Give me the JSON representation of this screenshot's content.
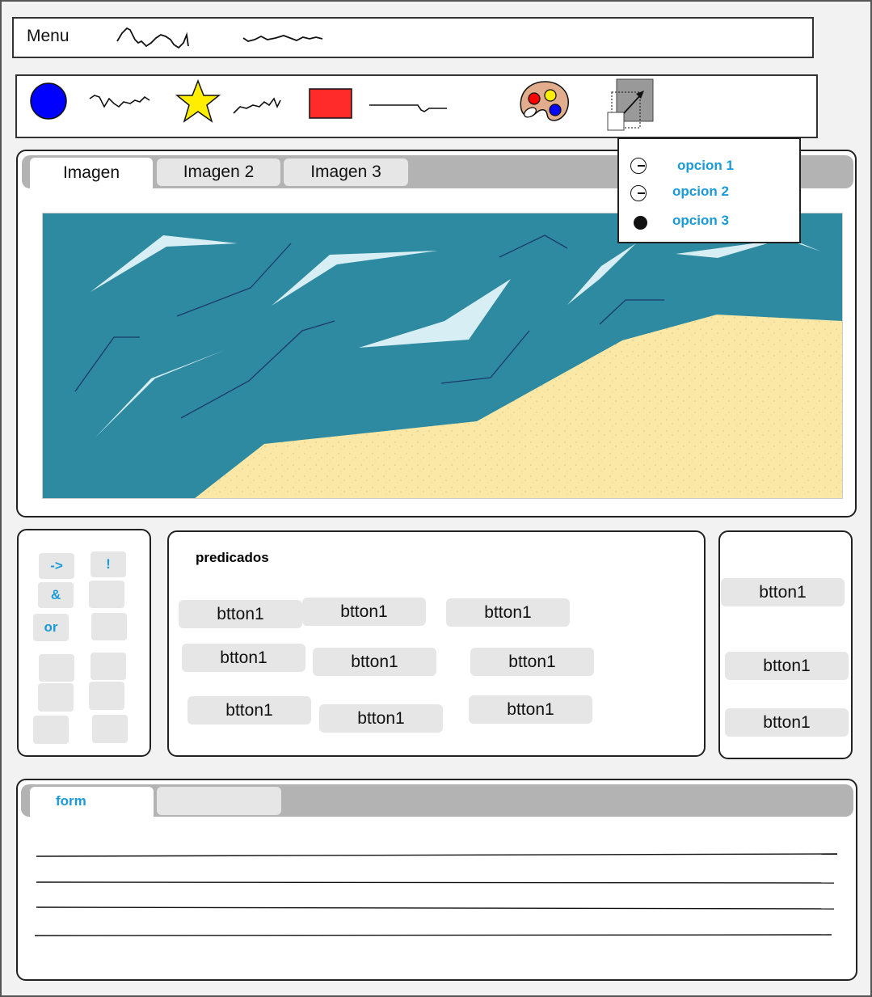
{
  "menu": {
    "label": "Menu"
  },
  "toolbar": {
    "tools": [
      {
        "icon": "circle-icon",
        "color": "#0000ff"
      },
      {
        "icon": "star-icon",
        "color": "#ffee00"
      },
      {
        "icon": "rectangle-icon",
        "color": "#ff2a2a"
      },
      {
        "icon": "palette-icon"
      },
      {
        "icon": "resize-icon"
      }
    ]
  },
  "popup": {
    "options": [
      {
        "label": "opcion 1",
        "selected": false
      },
      {
        "label": "opcion 2",
        "selected": false
      },
      {
        "label": "opcion 3",
        "selected": true
      }
    ]
  },
  "image_panel": {
    "tabs": [
      {
        "label": "Imagen",
        "active": true
      },
      {
        "label": "Imagen 2",
        "active": false
      },
      {
        "label": "Imagen 3",
        "active": false
      }
    ]
  },
  "operators": {
    "buttons": [
      "->",
      "!",
      "&",
      "",
      "or",
      "",
      "",
      "",
      "",
      "",
      "",
      ""
    ]
  },
  "predicates": {
    "title": "predicados",
    "buttons": [
      "btton1",
      "btton1",
      "btton1",
      "btton1",
      "btton1",
      "btton1",
      "btton1",
      "btton1",
      "btton1"
    ]
  },
  "right_panel": {
    "buttons": [
      "btton1",
      "btton1",
      "btton1"
    ]
  },
  "form_panel": {
    "tabs": [
      {
        "label": "form",
        "active": true
      },
      {
        "label": "",
        "active": false
      }
    ]
  },
  "colors": {
    "accent": "#1a9ad6",
    "sea": "#2e8aa0",
    "sand": "#fbe8a6",
    "button": "#e6e6e6",
    "tabstrip": "#b3b3b3"
  }
}
